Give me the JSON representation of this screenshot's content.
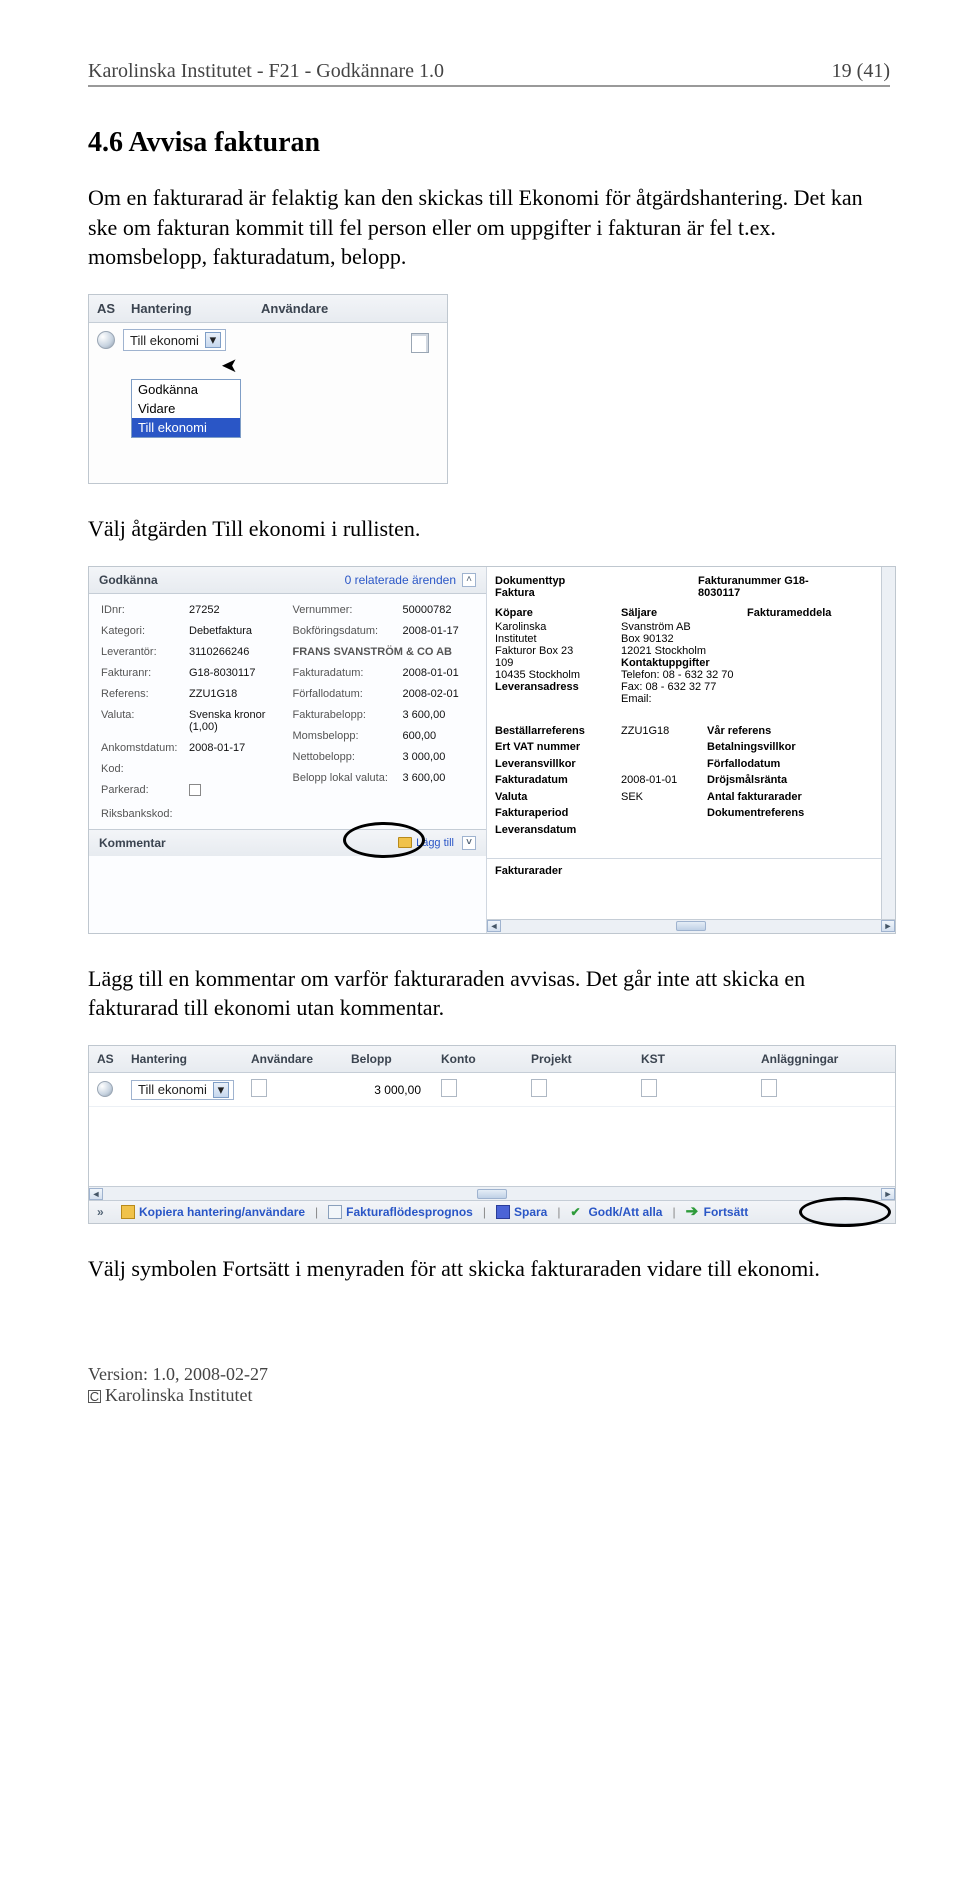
{
  "header": {
    "left": "Karolinska Institutet - F21 - Godkännare 1.0",
    "right": "19 (41)"
  },
  "sectionTitle": "4.6  Avvisa fakturan",
  "para1": "Om en fakturarad är felaktig kan den skickas till Ekonomi för åtgärdshantering. Det kan ske om fakturan kommit till fel person eller om uppgifter i fakturan är fel t.ex. momsbelopp, fakturadatum, belopp.",
  "shot1": {
    "cols": {
      "as": "AS",
      "hantering": "Hantering",
      "anvandare": "Användare"
    },
    "comboValue": "Till ekonomi",
    "dropdown": [
      "Godkänna",
      "Vidare",
      "Till ekonomi"
    ]
  },
  "para2": "Välj åtgärden Till ekonomi i rullisten.",
  "shot2": {
    "leftHeader": {
      "title": "Godkänna",
      "related": "0 relaterade ärenden"
    },
    "leftCol1": [
      {
        "k": "IDnr:",
        "v": "27252"
      },
      {
        "k": "Kategori:",
        "v": "Debetfaktura"
      },
      {
        "k": "Leverantör:",
        "v": "3110266246"
      },
      {
        "k": "Fakturanr:",
        "v": "G18-8030117"
      },
      {
        "k": "Referens:",
        "v": "ZZU1G18"
      },
      {
        "k": "Valuta:",
        "v": "Svenska kronor (1,00)"
      },
      {
        "k": "Ankomstdatum:",
        "v": "2008-01-17"
      },
      {
        "k": "Kod:",
        "v": ""
      },
      {
        "k": "Parkerad:",
        "v": ""
      },
      {
        "k": "Riksbankskod:",
        "v": ""
      }
    ],
    "leftCol2": [
      {
        "k": "Vernummer:",
        "v": "50000782"
      },
      {
        "k": "Bokföringsdatum:",
        "v": "2008-01-17"
      },
      {
        "k": "FRANS SVANSTRÖM & CO AB",
        "v": "",
        "bold": true
      },
      {
        "k": "Fakturadatum:",
        "v": "2008-01-01"
      },
      {
        "k": "Förfallodatum:",
        "v": "2008-02-01"
      },
      {
        "k": "Fakturabelopp:",
        "v": "3 600,00"
      },
      {
        "k": "Momsbelopp:",
        "v": "600,00"
      },
      {
        "k": "Nettobelopp:",
        "v": "3 000,00"
      },
      {
        "k": "Belopp lokal valuta:",
        "v": "3 600,00"
      }
    ],
    "kommentar": {
      "label": "Kommentar",
      "add": "Lägg till"
    },
    "invoice": {
      "top1": {
        "l": "Dokumenttyp",
        "r": "Fakturanummer  G18-"
      },
      "top2": {
        "l": "Faktura",
        "r": "8030117"
      },
      "buyer": {
        "title": "Köpare",
        "lines": [
          "Karolinska",
          "Institutet",
          "Fakturor Box 23",
          "109",
          "10435 Stockholm",
          "Leveransadress"
        ]
      },
      "seller": {
        "title": "Säljare",
        "lines": [
          "Svanström AB",
          "Box 90132",
          "12021 Stockholm",
          "Kontaktuppgifter",
          "Telefon:   08 - 632 32 70",
          "Fax:        08 - 632 32 77",
          "Email:"
        ]
      },
      "msg": "Fakturameddela",
      "block": {
        "labels": [
          "Beställarreferens",
          "Ert VAT nummer",
          "Leveransvillkor",
          "Fakturadatum",
          "Valuta",
          "Fakturaperiod",
          "Leveransdatum"
        ],
        "vals": [
          "ZZU1G18",
          "",
          "",
          "2008-01-01",
          "SEK",
          "",
          ""
        ],
        "labels2": [
          "Vår referens",
          "Betalningsvillkor",
          "Förfallodatum",
          "Dröjsmålsränta",
          "Antal fakturarader",
          "Dokumentreferens"
        ]
      },
      "rows": "Fakturarader"
    }
  },
  "para3": "Lägg till en kommentar om varför fakturaraden avvisas. Det går inte att skicka en fakturarad till ekonomi utan kommentar.",
  "shot3": {
    "cols": [
      "AS",
      "Hantering",
      "Användare",
      "Belopp",
      "Konto",
      "Projekt",
      "KST",
      "Anläggningar"
    ],
    "row": {
      "combo": "Till ekonomi",
      "belopp": "3 000,00"
    },
    "actions": {
      "copy": "Kopiera hantering/användare",
      "prog": "Fakturaflödesprognos",
      "save": "Spara",
      "approve": "Godk/Att alla",
      "forward": "Fortsätt"
    }
  },
  "para4": "Välj symbolen Fortsätt i menyraden för att skicka fakturaraden vidare till ekonomi.",
  "footer": {
    "version": "Version: 1.0, 2008-02-27",
    "org": "Karolinska Institutet"
  }
}
